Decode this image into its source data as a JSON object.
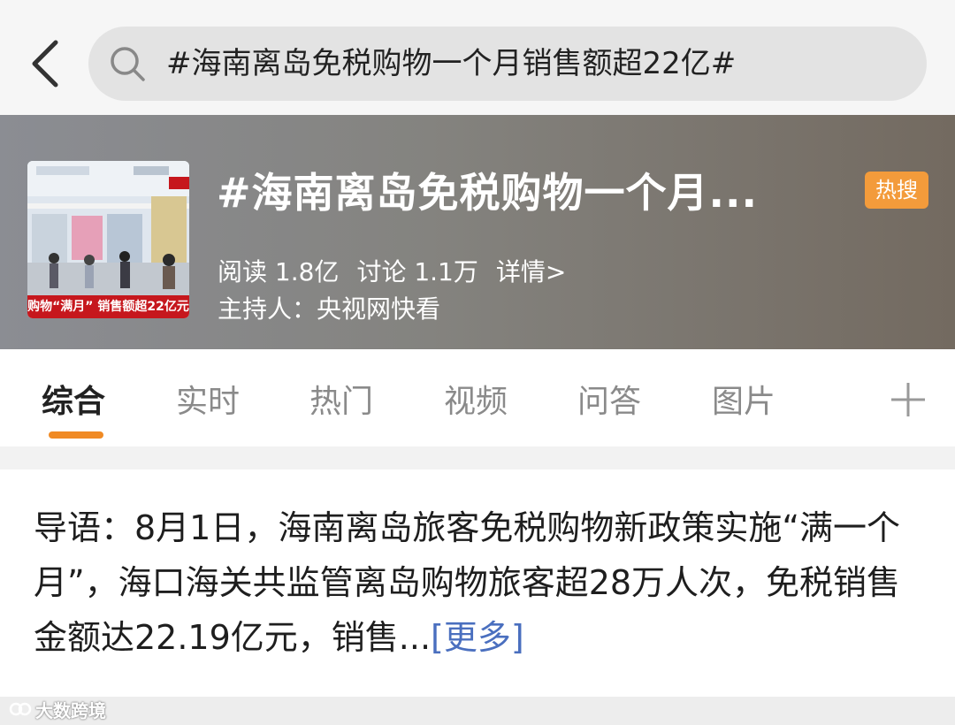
{
  "search": {
    "query": "#海南离岛免税购物一个月销售额超22亿#"
  },
  "topic": {
    "thumbnail_caption": "购物“满月” 销售额超22亿元",
    "title": "#海南离岛免税购物一个月...",
    "badge": "热搜",
    "badge_color": "#f39b3b",
    "reads": "阅读 1.8亿",
    "discussions": "讨论 1.1万",
    "details_link": "详情>",
    "host": "主持人：央视网快看"
  },
  "tabs": [
    {
      "label": "综合",
      "active": true
    },
    {
      "label": "实时",
      "active": false
    },
    {
      "label": "热门",
      "active": false
    },
    {
      "label": "视频",
      "active": false
    },
    {
      "label": "问答",
      "active": false
    },
    {
      "label": "图片",
      "active": false
    }
  ],
  "lead": {
    "text": "导语：8月1日，海南离岛旅客免税购物新政策实施“满一个月”，海口海关共监管离岛购物旅客超28万人次，免税销售金额达22.19亿元，销售...",
    "more": "[更多]"
  },
  "watermark": "大数跨境",
  "colors": {
    "accent": "#f08a24",
    "link": "#4a6fbf"
  },
  "icons": [
    "back-arrow-icon",
    "search-icon",
    "plus-icon"
  ]
}
